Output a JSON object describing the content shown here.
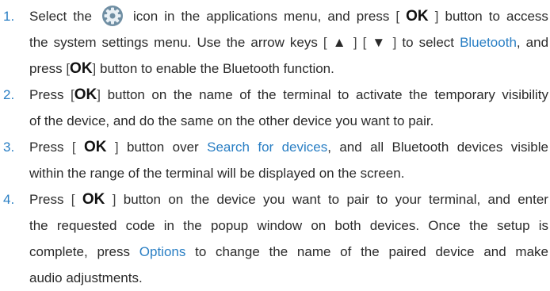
{
  "ok": "OK",
  "up_arrow": "▲",
  "down_arrow": "▼",
  "accent_color": "#2a7fc4",
  "icon_color": "#6f8ea3",
  "steps": [
    {
      "number": "1.",
      "select_the": "Select the",
      "icon_name": "settings-gear-icon",
      "s1_rest": "icon in the applications menu, and press",
      "s1_button_to_access": "button to access",
      "s1_line2_a": "the system settings menu. Use the arrow keys",
      "s1_to_select": "to select",
      "bluetooth": "Bluetooth",
      "and": ", and",
      "press": "press",
      "s1_enable": "button to enable the Bluetooth function."
    },
    {
      "number": "2.",
      "press": "Press",
      "s2_line1_rest": "button on the name of the terminal to activate the temporary visibility",
      "s2_line2": "of the device, and do the same on the other device you want to pair."
    },
    {
      "number": "3.",
      "press": "Press",
      "s3_button_over": "button over",
      "search_for_devices": "Search for devices",
      "s3_line1_rest": ", and all Bluetooth devices visible",
      "s3_line2": "within the range of the terminal will be displayed on the screen."
    },
    {
      "number": "4.",
      "press": "Press",
      "s4_line1_rest": "button on the device you want to pair to your terminal, and enter",
      "s4_line2": "the requested code in the popup window on both devices. Once the setup is",
      "s4_line3_a": "complete, press",
      "options": "Options",
      "s4_line3_b": "to change the name of the paired device and make",
      "s4_line4": "audio adjustments."
    }
  ]
}
